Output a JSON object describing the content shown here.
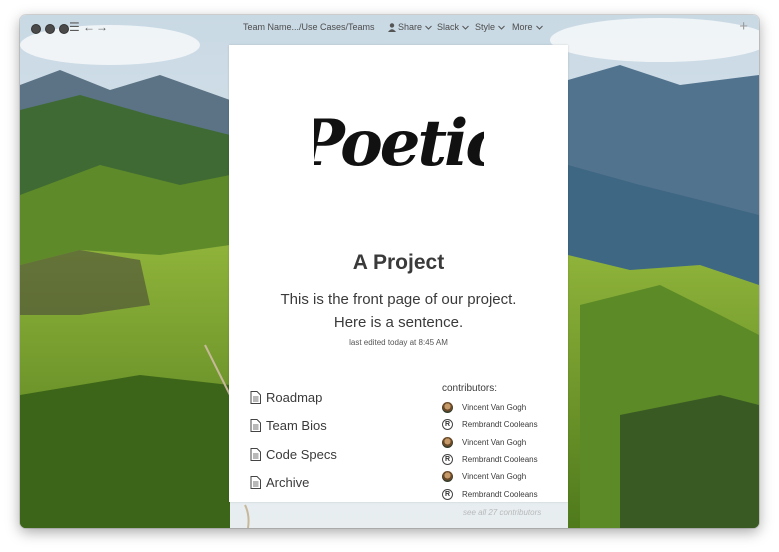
{
  "titlebar": {
    "breadcrumb": "Team Name.../Use Cases/Teams",
    "share_label": "Share",
    "slack_label": "Slack",
    "style_label": "Style",
    "more_label": "More"
  },
  "page": {
    "logo_text": "Poetic",
    "title": "A Project",
    "intro_line1": "This is the front page of our project.",
    "intro_line2": "Here is a sentence.",
    "last_edited": "last edited today at 8:45 AM"
  },
  "links": [
    {
      "label": "Roadmap",
      "icon": "document-icon"
    },
    {
      "label": "Team Bios",
      "icon": "document-icon"
    },
    {
      "label": "Code Specs",
      "icon": "document-icon"
    },
    {
      "label": "Archive",
      "icon": "document-icon"
    }
  ],
  "contributors": {
    "heading": "contributors:",
    "people": [
      {
        "name": "Vincent Van Gogh",
        "avatar": "photo"
      },
      {
        "name": "Rembrandt Cooleans",
        "avatar": "R"
      },
      {
        "name": "Vincent Van Gogh",
        "avatar": "photo"
      },
      {
        "name": "Rembrandt Cooleans",
        "avatar": "R"
      },
      {
        "name": "Vincent Van Gogh",
        "avatar": "photo"
      },
      {
        "name": "Rembrandt Cooleans",
        "avatar": "R"
      }
    ],
    "see_all": "see all 27 contributors"
  }
}
